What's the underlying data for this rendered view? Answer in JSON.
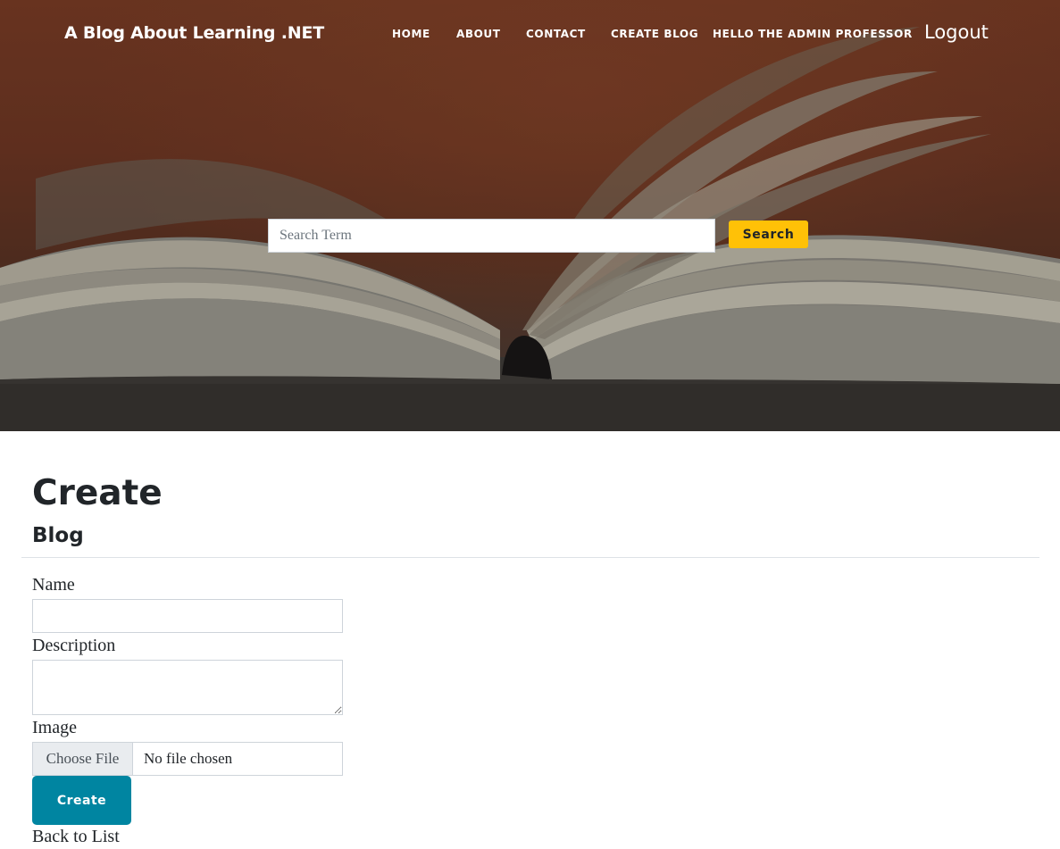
{
  "header": {
    "brand": "A Blog About Learning .NET",
    "nav": {
      "home": "HOME",
      "about": "ABOUT",
      "contact": "CONTACT",
      "create_blog": "CREATE BLOG",
      "greeting": "HELLO THE ADMIN PROFESSOR"
    },
    "logout": "Logout"
  },
  "search": {
    "placeholder": "Search Term",
    "value": "",
    "button_label": "Search"
  },
  "main": {
    "title": "Create",
    "subtitle": "Blog",
    "form": {
      "name_label": "Name",
      "name_value": "",
      "description_label": "Description",
      "description_value": "",
      "image_label": "Image",
      "choose_file_label": "Choose File",
      "file_status": "No file chosen",
      "submit_label": "Create"
    },
    "back_link": "Back to List"
  },
  "colors": {
    "accent_button": "#0085a1",
    "search_button": "#ffc107",
    "text": "#212529"
  }
}
